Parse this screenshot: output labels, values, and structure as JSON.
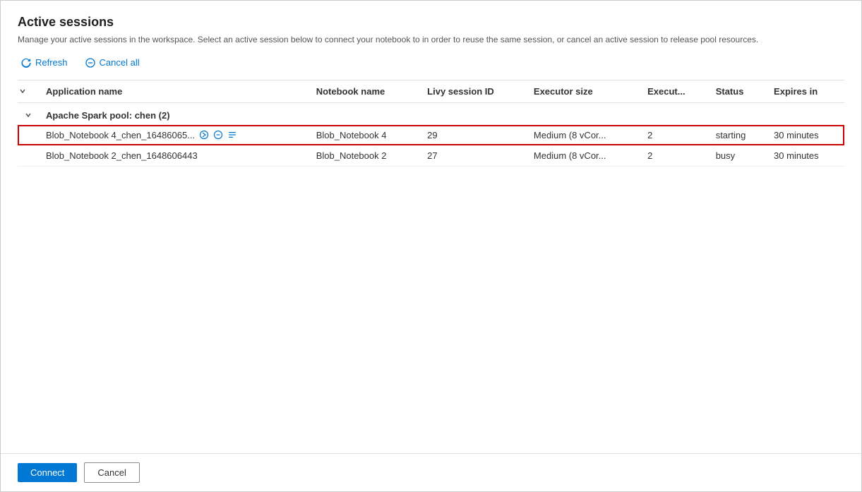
{
  "page": {
    "title": "Active sessions",
    "description": "Manage your active sessions in the workspace. Select an active session below to connect your notebook to in order to reuse the same session, or cancel an active session to release pool resources."
  },
  "toolbar": {
    "refresh_label": "Refresh",
    "cancel_all_label": "Cancel all"
  },
  "table": {
    "columns": [
      {
        "key": "chevron",
        "label": ""
      },
      {
        "key": "app_name",
        "label": "Application name"
      },
      {
        "key": "notebook_name",
        "label": "Notebook name"
      },
      {
        "key": "livy_session_id",
        "label": "Livy session ID"
      },
      {
        "key": "executor_size",
        "label": "Executor size"
      },
      {
        "key": "executors",
        "label": "Execut..."
      },
      {
        "key": "status",
        "label": "Status"
      },
      {
        "key": "expires_in",
        "label": "Expires in"
      }
    ],
    "groups": [
      {
        "name": "Apache Spark pool: chen (2)",
        "rows": [
          {
            "app_name": "Blob_Notebook 4_chen_16486065...",
            "notebook_name": "Blob_Notebook 4",
            "livy_session_id": "29",
            "executor_size": "Medium (8 vCor...",
            "executors": "2",
            "status": "starting",
            "expires_in": "30 minutes",
            "selected": true
          },
          {
            "app_name": "Blob_Notebook 2_chen_1648606443",
            "notebook_name": "Blob_Notebook 2",
            "livy_session_id": "27",
            "executor_size": "Medium (8 vCor...",
            "executors": "2",
            "status": "busy",
            "expires_in": "30 minutes",
            "selected": false
          }
        ]
      }
    ]
  },
  "footer": {
    "connect_label": "Connect",
    "cancel_label": "Cancel"
  }
}
